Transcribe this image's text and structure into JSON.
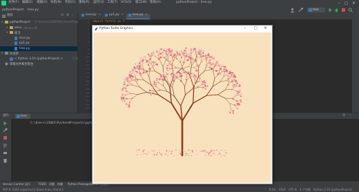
{
  "titlebar": {
    "app": "pythonProject",
    "file": "tree.py",
    "menu": [
      "文件(F)",
      "编辑(E)",
      "视图(V)",
      "导航(N)",
      "代码(C)",
      "重构(R)",
      "运行(U)",
      "工具(T)",
      "VCS(S)",
      "窗口(W)",
      "帮助(H)"
    ]
  },
  "toolbar": {
    "run_config": "tree"
  },
  "project": {
    "header": "项目",
    "items": [
      {
        "label": "pythonProject",
        "hint": "C:\\Users\\23665\\PycharmProjects\\pythonProject",
        "icon": "folder-icon",
        "depth": 1
      },
      {
        "label": "venv",
        "hint": "library 根",
        "icon": "folder-icon",
        "depth": 2
      },
      {
        "label": "练习",
        "hint": "",
        "icon": "folder-icon",
        "depth": 2
      },
      {
        "label": "love.py",
        "hint": "",
        "icon": "python-file-icon",
        "depth": 3
      },
      {
        "label": "py1.py",
        "hint": "",
        "icon": "python-file-icon",
        "depth": 3
      },
      {
        "label": "tree.py",
        "hint": "",
        "icon": "python-file-icon",
        "depth": 3
      },
      {
        "label": "外部库",
        "hint": "",
        "icon": "library-icon",
        "depth": 1
      },
      {
        "label": "< Python 3.10 (pythonProject) >",
        "hint": "C:\\Users\\...",
        "icon": "python-icon",
        "depth": 2
      },
      {
        "label": "草稿文件和控制台",
        "hint": "",
        "icon": "scratch-icon",
        "depth": 1
      }
    ]
  },
  "editor": {
    "tabs": [
      "love.py",
      "py1.py",
      "tree.py"
    ],
    "active_tab": "tree.py",
    "line_numbers": [
      "1",
      "2",
      "3",
      "4",
      "5",
      "6",
      "7",
      "8",
      "9",
      "10",
      "11",
      "12",
      "13",
      "14",
      "15",
      "16",
      "17",
      "18",
      "19",
      "20",
      "21",
      "22",
      "23"
    ],
    "code_line_1": "import turtle as T"
  },
  "run": {
    "label": "运行:",
    "tab": "tree",
    "console_line": "C:\\Users\\23665\\PycharmProjects\\python"
  },
  "bottom_tools": [
    "Version Control",
    "运行",
    "TODO",
    "问题",
    "终端",
    "Python Packages",
    "Python 控制台"
  ],
  "status": {
    "left": "PEP 8: E302 expected 2 blank lines, found 1",
    "position": "6:20",
    "line_sep": "CRLF",
    "encoding": "UTF-8",
    "indent": "4 个空格",
    "interpreter": "Python 3.10 (pythonProject)"
  },
  "turtle_window": {
    "title": "Python Turtle Graphics",
    "canvas_color": "#f8e2bd",
    "trunk_color": "#8b3a1a",
    "blossom_color": "#f2a0a8"
  },
  "colors": {
    "ide_bg": "#2b2b2b",
    "panel_bg": "#3c3f41",
    "accent": "#4a88c7",
    "run_green": "#499c54"
  }
}
